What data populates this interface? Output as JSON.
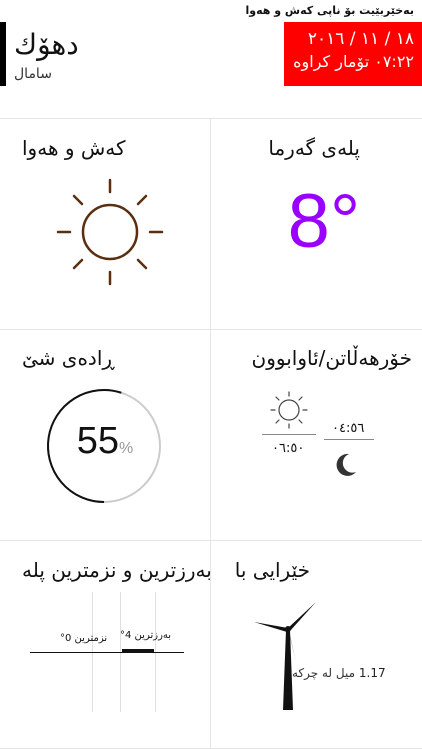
{
  "header": {
    "banner": "بەخێربێیت بۆ ناپی کەش و هەوا",
    "city": "دهۆك",
    "region": "سامال",
    "date": "١٨ / ١١ / ٢٠١٦",
    "updated": "٠٧:٢٢ تۆمار کراوە"
  },
  "tiles": {
    "weather_title": "کەش و هەوا",
    "temp_title": "پلەی گەرما",
    "temp_value": "8°",
    "humidity_title": "ڕادەی شێ",
    "humidity_value": "55",
    "humidity_unit": "%",
    "humidity_fraction": 0.55,
    "sun_title": "خۆرهەڵاتن/ئاوابوون",
    "sunrise": "٠٤:٥٦",
    "sunset": "٠٦:٥٠",
    "range_title": "بەرزترین و نزمترین پلە",
    "high_label": "بەرزترین 4°",
    "low_label": "نزمترین 0°",
    "wind_title": "خێرایی با",
    "wind_value": "1.17",
    "wind_unit": "میل لە چرکە"
  },
  "colors": {
    "accent": "#ff0000",
    "temperature": "#9900ff",
    "sun_icon": "#5a2e0e"
  }
}
